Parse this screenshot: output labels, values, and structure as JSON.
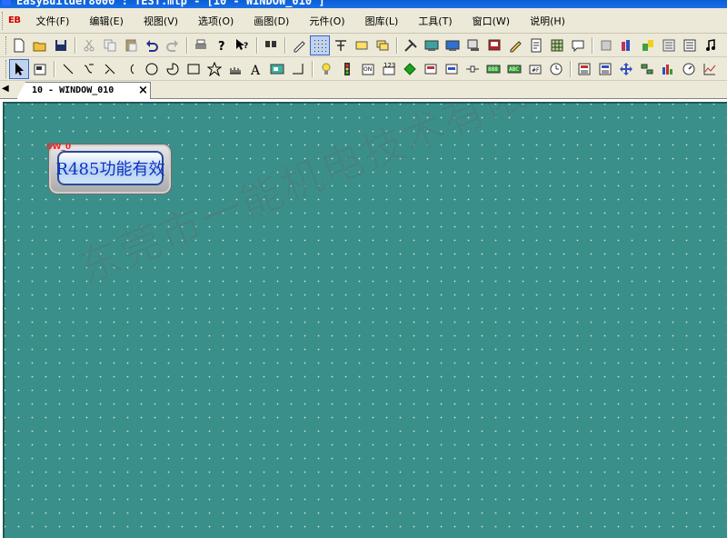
{
  "window": {
    "title": "EasyBuilder8000 : TEST.mtp - [10 - WINDOW_010 ]"
  },
  "menubar": {
    "logo": "EB",
    "items": [
      {
        "label": "文件(F)"
      },
      {
        "label": "编辑(E)"
      },
      {
        "label": "视图(V)"
      },
      {
        "label": "选项(O)"
      },
      {
        "label": "画图(D)"
      },
      {
        "label": "元件(O)"
      },
      {
        "label": "图库(L)"
      },
      {
        "label": "工具(T)"
      },
      {
        "label": "窗口(W)"
      },
      {
        "label": "说明(H)"
      }
    ]
  },
  "toolbar1": {
    "icons": [
      "new-icon",
      "open-icon",
      "save-icon",
      "cut-icon",
      "copy-icon",
      "paste-icon",
      "undo-icon",
      "redo-icon",
      "print-icon",
      "help-icon",
      "context-help-icon",
      "find-icon",
      "pen-icon",
      "grid-icon",
      "align-icon",
      "window-icon",
      "layer-icon",
      "tools-icon",
      "compile-icon",
      "simulate-icon",
      "download-icon",
      "record-icon",
      "edit-icon",
      "page-icon",
      "table-icon",
      "chat-icon",
      "transfer-icon",
      "library-icon",
      "object-icon",
      "list-icon",
      "list2-icon",
      "music-icon"
    ]
  },
  "toolbar2": {
    "icons": [
      "select-arrow-icon",
      "property-icon",
      "line-icon",
      "polyline-icon",
      "arc-icon",
      "half-arc-icon",
      "circle-icon",
      "pie-icon",
      "rectangle-icon",
      "star-icon",
      "scale-icon",
      "text-icon",
      "picture-icon",
      "dimension-icon",
      "bit-lamp-icon",
      "word-lamp-icon",
      "set-bit-icon",
      "number-input-icon",
      "function-key-icon",
      "toggle-icon",
      "slide-icon",
      "multistate-icon",
      "data-display-icon",
      "ascii-icon",
      "date-icon",
      "clock-icon",
      "alarm-bar-icon",
      "event-display-icon",
      "move-icon",
      "animation-icon",
      "bar-chart-icon",
      "meter-icon",
      "trend-icon"
    ]
  },
  "tabs": [
    {
      "label": "10 - WINDOW_010",
      "close": "×"
    }
  ],
  "tab_scroll": "◀",
  "canvas": {
    "background": "#3a8f8a",
    "switch": {
      "tag": "SW_0",
      "label": "R485功能有效"
    },
    "watermark": "东莞市一能机电技术有限公司"
  }
}
